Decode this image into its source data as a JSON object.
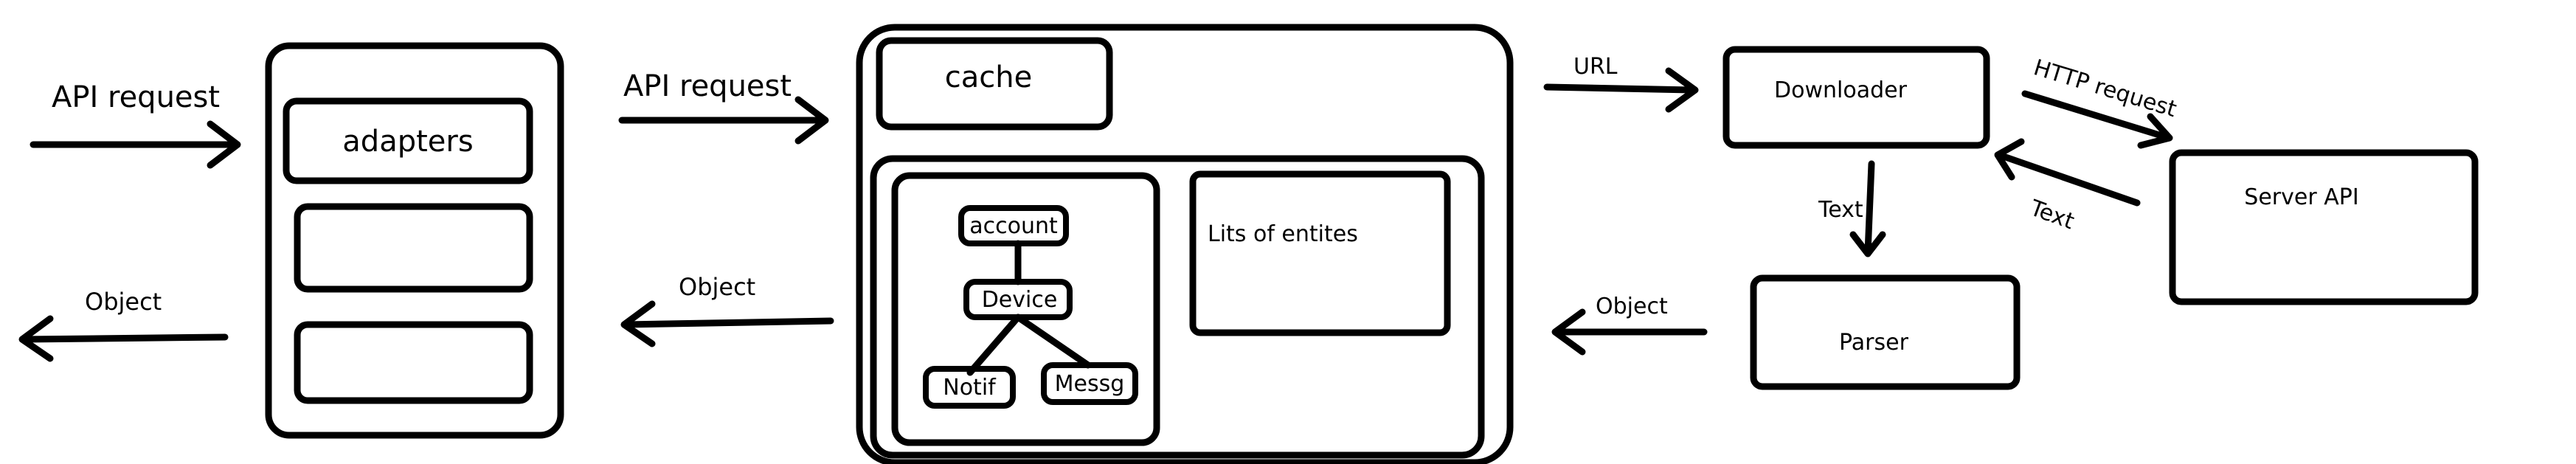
{
  "labels": {
    "api_request_in": "API request",
    "object_out": "Object",
    "api_request_mid": "API request",
    "object_mid": "Object",
    "url": "URL",
    "http_request": "HTTP request",
    "text_back": "Text",
    "text_down": "Text",
    "object_right": "Object"
  },
  "adapters": {
    "title": "adapters"
  },
  "cache": {
    "title": "cache",
    "tree": {
      "root": "account",
      "middle": "Device",
      "left_leaf": "Notif",
      "right_leaf": "Messg"
    },
    "list_title": "Lits of entites"
  },
  "downloader": {
    "title": "Downloader"
  },
  "server_api": {
    "title": "Server API"
  },
  "parser": {
    "title": "Parser"
  }
}
